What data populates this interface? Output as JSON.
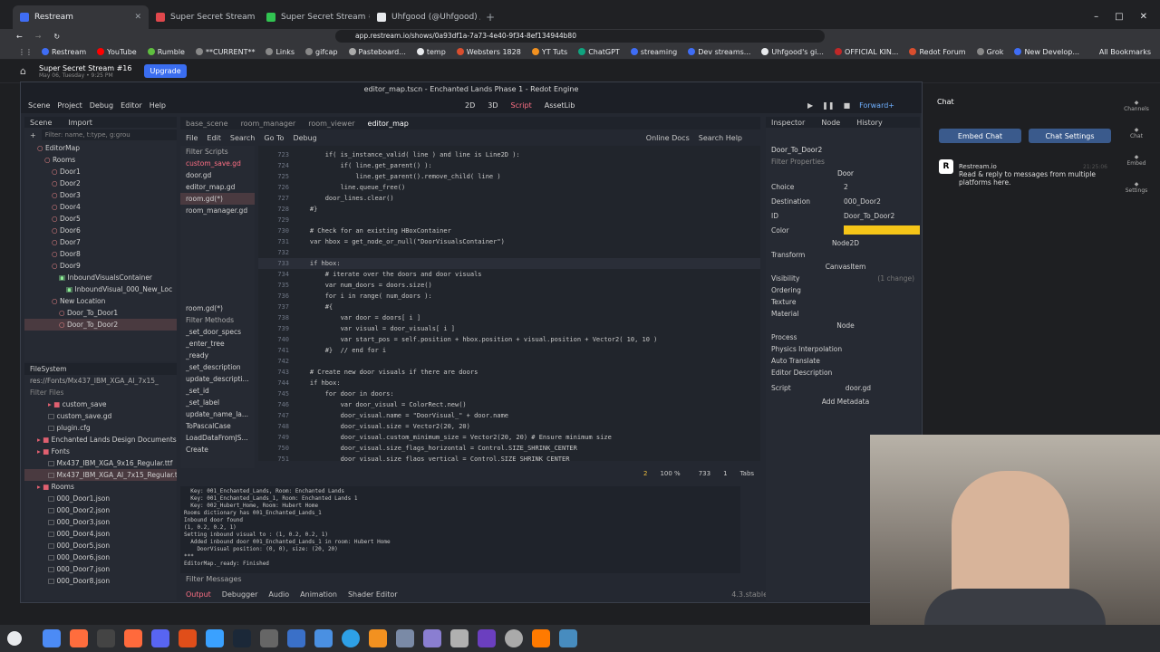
{
  "browser": {
    "tabs": [
      {
        "label": "Restream",
        "active": true,
        "color": "#3f6df5"
      },
      {
        "label": "Super Secret Stream",
        "active": false,
        "color": "#e0474c"
      },
      {
        "label": "Super Secret Stream #16",
        "active": false,
        "color": "#31c451"
      },
      {
        "label": "Uhfgood (@Uhfgood) / X",
        "active": false,
        "color": "#e8eaed"
      }
    ],
    "url": "app.restream.io/shows/0a93df1a-7a73-4e40-9f34-8ef134944b80",
    "bookmarks": [
      "Restream",
      "YouTube",
      "Rumble",
      "**CURRENT**",
      "Links",
      "gifcap",
      "Pasteboard...",
      "temp",
      "Websters 1828",
      "YT Tuts",
      "ChatGPT",
      "streaming",
      "Dev streams...",
      "Uhfgood's gi...",
      "OFFICIAL KIN...",
      "Redot Forum",
      "Grok",
      "New Develop..."
    ],
    "all_bookmarks": "All Bookmarks"
  },
  "restream": {
    "show_title": "Super Secret Stream #16",
    "show_date": "May 06, Tuesday • 9:25 PM",
    "upgrade": "Upgrade"
  },
  "editor": {
    "window_title": "editor_map.tscn - Enchanted Lands Phase 1 - Redot Engine",
    "menu": [
      "Scene",
      "Project",
      "Debug",
      "Editor",
      "Help"
    ],
    "modes": [
      "2D",
      "3D",
      "Script",
      "AssetLib"
    ],
    "renderer": "Forward+",
    "scene_tabs": [
      "Scene",
      "Import"
    ],
    "scene_filter": "Filter: name, t:type, g:grou",
    "tree": [
      "EditorMap",
      "Rooms",
      "Door1",
      "Door2",
      "Door3",
      "Door4",
      "Door5",
      "Door6",
      "Door7",
      "Door8",
      "Door9",
      "InboundVisualsContainer",
      "InboundVisual_000_New_Loc",
      "New Location",
      "Door_To_Door1",
      "Door_To_Door2"
    ],
    "filesystem": {
      "title": "FileSystem",
      "path": "res://Fonts/Mx437_IBM_XGA_AI_7x15_",
      "filter": "Filter Files",
      "items": [
        "custom_save",
        "custom_save.gd",
        "plugin.cfg",
        "Enchanted Lands Design Documents",
        "Fonts",
        "Mx437_IBM_XGA_9x16_Regular.ttf",
        "Mx437_IBM_XGA_AI_7x15_Regular.ttf",
        "Rooms",
        "000_Door1.json",
        "000_Door2.json",
        "000_Door3.json",
        "000_Door4.json",
        "000_Door5.json",
        "000_Door6.json",
        "000_Door7.json",
        "000_Door8.json"
      ]
    },
    "file_tabs": [
      "base_scene",
      "room_manager",
      "room_viewer",
      "editor_map"
    ],
    "script_menu": [
      "File",
      "Edit",
      "Search",
      "Go To",
      "Debug"
    ],
    "online_docs": "Online Docs",
    "search_help": "Search Help",
    "filter_scripts": "Filter Scripts",
    "scripts": [
      "custom_save.gd",
      "door.gd",
      "editor_map.gd",
      "room.gd(*)",
      "room_manager.gd"
    ],
    "current_script": "room.gd(*)",
    "filter_methods": "Filter Methods",
    "methods": [
      "_set_door_specs",
      "_enter_tree",
      "_ready",
      "_set_description",
      "update_descripti...",
      "_set_id",
      "_set_label",
      "update_name_la...",
      "ToPascalCase",
      "LoadDataFromJS...",
      "Create"
    ],
    "code": [
      {
        "n": "723",
        "t": "        if( is_instance_valid( line ) and line is Line2D ):"
      },
      {
        "n": "724",
        "t": "            if( line.get_parent() ):"
      },
      {
        "n": "725",
        "t": "                line.get_parent().remove_child( line )"
      },
      {
        "n": "726",
        "t": "            line.queue_free()"
      },
      {
        "n": "727",
        "t": "        door_lines.clear()"
      },
      {
        "n": "728",
        "t": "    #}"
      },
      {
        "n": "729",
        "t": ""
      },
      {
        "n": "730",
        "t": "    # Check for an existing HBoxContainer"
      },
      {
        "n": "731",
        "t": "    var hbox = get_node_or_null(\"DoorVisualsContainer\")"
      },
      {
        "n": "732",
        "t": ""
      },
      {
        "n": "733",
        "t": "    if hbox:"
      },
      {
        "n": "734",
        "t": "        # iterate over the doors and door visuals"
      },
      {
        "n": "735",
        "t": "        var num_doors = doors.size()"
      },
      {
        "n": "736",
        "t": "        for i in range( num_doors ):"
      },
      {
        "n": "737",
        "t": "        #{"
      },
      {
        "n": "738",
        "t": "            var door = doors[ i ]"
      },
      {
        "n": "739",
        "t": "            var visual = door_visuals[ i ]"
      },
      {
        "n": "740",
        "t": "            var start_pos = self.position + hbox.position + visual.position + Vector2( 10, 10 )"
      },
      {
        "n": "741",
        "t": "        #}  // end for i"
      },
      {
        "n": "742",
        "t": ""
      },
      {
        "n": "743",
        "t": "    # Create new door visuals if there are doors"
      },
      {
        "n": "744",
        "t": "    if hbox:"
      },
      {
        "n": "745",
        "t": "        for door in doors:"
      },
      {
        "n": "746",
        "t": "            var door_visual = ColorRect.new()"
      },
      {
        "n": "747",
        "t": "            door_visual.name = \"DoorVisual_\" + door.name"
      },
      {
        "n": "748",
        "t": "            door_visual.size = Vector2(20, 20)"
      },
      {
        "n": "749",
        "t": "            door_visual.custom_minimum_size = Vector2(20, 20) # Ensure minimum size"
      },
      {
        "n": "750",
        "t": "            door_visual.size_flags_horizontal = Control.SIZE_SHRINK_CENTER"
      },
      {
        "n": "751",
        "t": "            door_visual.size_flags_vertical = Control.SIZE_SHRINK_CENTER"
      }
    ],
    "status": {
      "warnings": "2",
      "zoom": "100 %",
      "line": "733",
      "col": "1",
      "indent": "Tabs"
    },
    "output": [
      "  Key: 001_Enchanted_Lands, Room: Enchanted Lands",
      "  Key: 001_Enchanted_Lands_1, Room: Enchanted Lands 1",
      "  Key: 002_Hubert_Home, Room: Hubert Home",
      "Rooms dictionary has 001_Enchanted_Lands_1",
      "Inbound door found",
      "(1, 0.2, 0.2, 1)",
      "Setting inbound visual to : (1, 0.2, 0.2, 1)",
      "  Added inbound door 001_Enchanted_Lands_1 in room: Hubert Home",
      "    DoorVisual position: (0, 0), size: (20, 20)",
      "***",
      "EditorMap._ready: Finished"
    ],
    "filter_messages": "Filter Messages",
    "bottom_tabs": [
      "Output",
      "Debugger",
      "Audio",
      "Animation",
      "Shader Editor"
    ],
    "version": "4.3.stable",
    "log_counts": [
      "1464",
      "0",
      "0",
      "2"
    ],
    "inspector": {
      "tabs": [
        "Inspector",
        "Node",
        "History"
      ],
      "node": "Door_To_Door2",
      "filter": "Filter Properties",
      "section": "Door",
      "props": [
        {
          "k": "Choice",
          "v": "2"
        },
        {
          "k": "Destination",
          "v": "000_Door2"
        },
        {
          "k": "ID",
          "v": "Door_To_Door2"
        },
        {
          "k": "Color",
          "v": ""
        }
      ],
      "color": "#f5c518",
      "groups": [
        "Node2D",
        "Transform",
        "CanvasItem",
        "Visibility",
        "Ordering",
        "Texture",
        "Material",
        "Node",
        "Process",
        "Physics Interpolation",
        "Auto Translate",
        "Editor Description"
      ],
      "visibility_note": "(1 change)",
      "script_label": "Script",
      "script_value": "door.gd",
      "add_metadata": "Add Metadata"
    }
  },
  "chat": {
    "title": "Chat",
    "embed": "Embed Chat",
    "settings": "Chat Settings",
    "sender": "Restream.io",
    "time": "21:25:06",
    "message": "Read & reply to messages from multiple platforms here.",
    "side": [
      "Channels",
      "Chat",
      "Embed",
      "Settings"
    ]
  }
}
